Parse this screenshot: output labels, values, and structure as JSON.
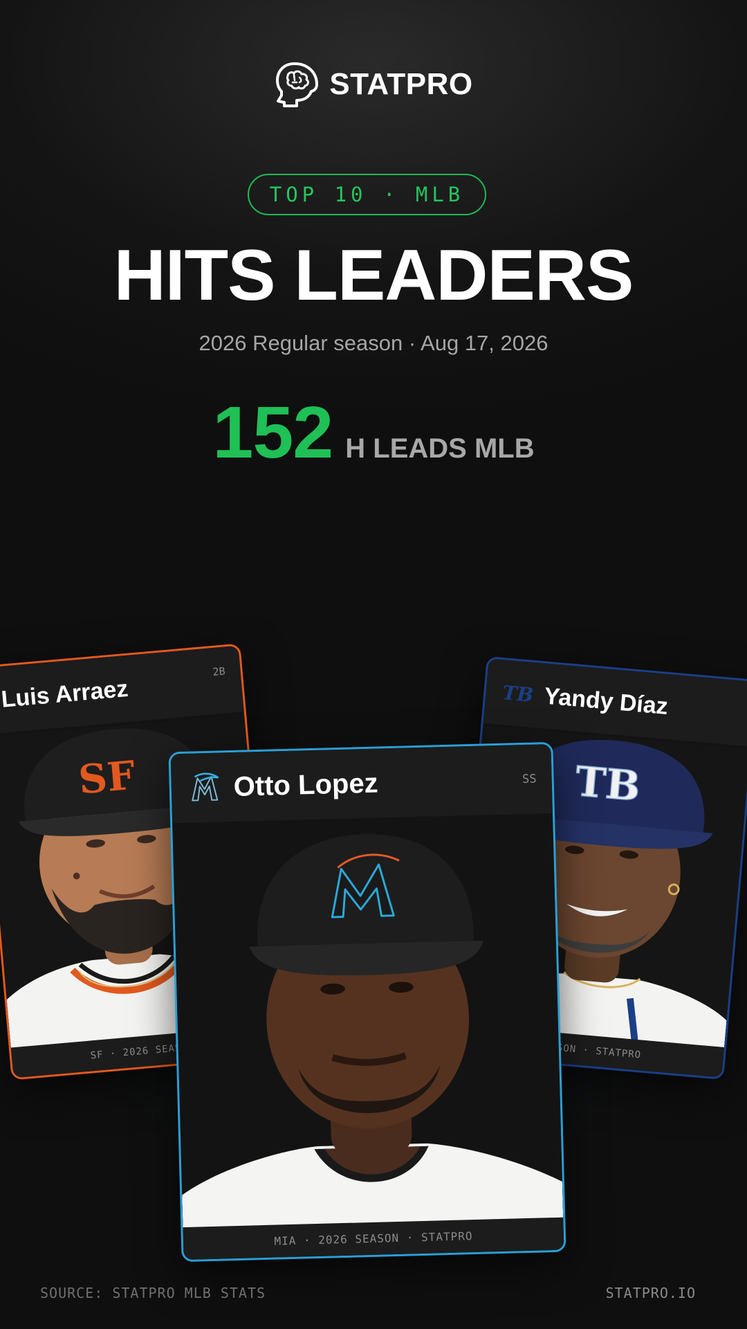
{
  "brand": {
    "name": "STATPRO",
    "logo_icon": "brain-head-icon"
  },
  "badge": {
    "label": "TOP 10 · MLB"
  },
  "headline": {
    "title": "HITS LEADERS",
    "subtitle": "2026 Regular season · Aug 17, 2026"
  },
  "stat": {
    "value": "152",
    "label": "H LEADS MLB",
    "color": "#1fc055"
  },
  "cards": {
    "left": {
      "name": "Luis Arraez",
      "position": "2B",
      "footer": "SF · 2026 SEASON",
      "team_logo": "sf-giants-logo",
      "accent": "#e2591f"
    },
    "center": {
      "name": "Otto Lopez",
      "position": "SS",
      "footer": "MIA · 2026 SEASON · STATPRO",
      "team_logo": "miami-marlins-logo",
      "accent": "#2a9fd6"
    },
    "right": {
      "name": "Yandy Díaz",
      "position": "",
      "footer": "SEASON · STATPRO",
      "team_logo": "tampa-bay-rays-logo",
      "accent": "#1b3f86"
    }
  },
  "footer": {
    "source": "SOURCE: STATPRO MLB STATS",
    "site": "STATPRO.IO"
  }
}
